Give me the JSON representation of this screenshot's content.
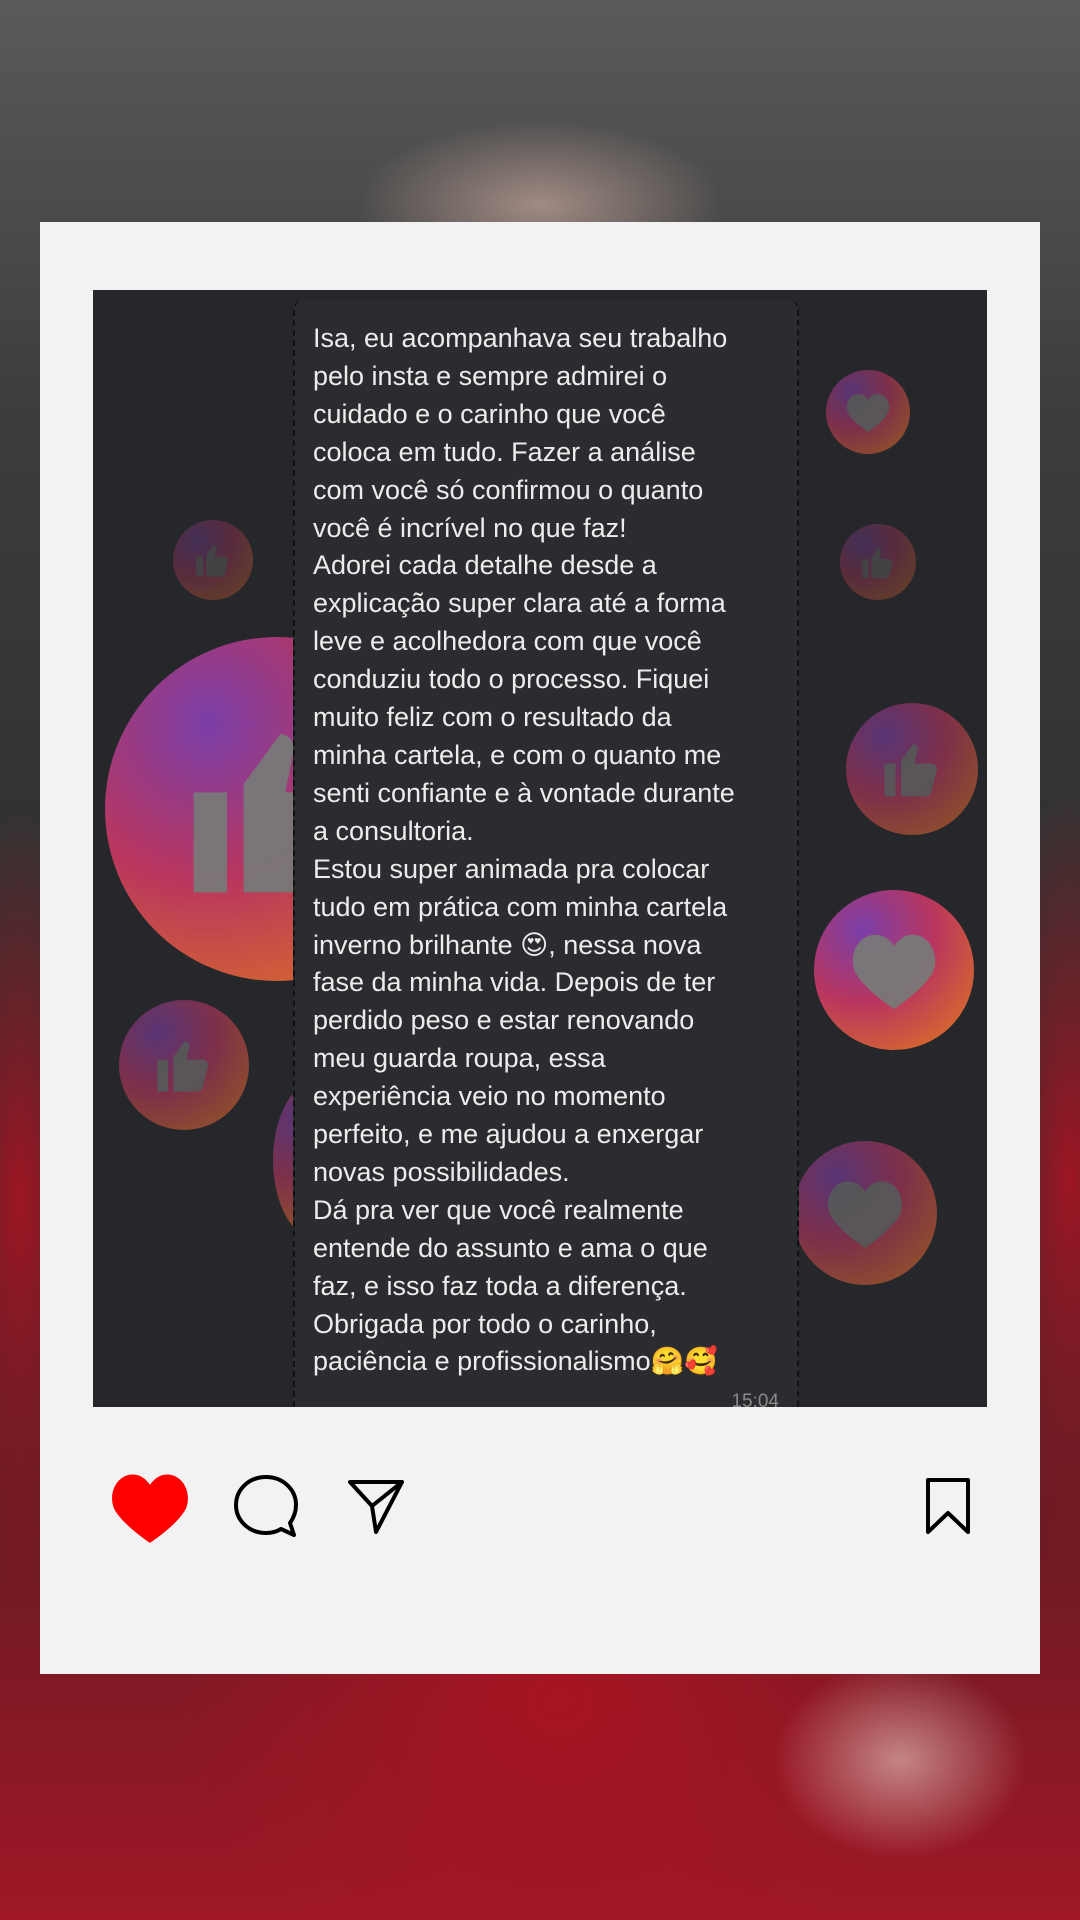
{
  "message": {
    "lines": [
      "Isa, eu acompanhava seu trabalho",
      "pelo insta e sempre admirei o",
      "cuidado e o carinho que você",
      "coloca em tudo. Fazer a análise",
      "com você só confirmou o quanto",
      "você é incrível no que faz!",
      "Adorei cada detalhe desde a",
      "explicação super clara até a forma",
      "leve e acolhedora com que você",
      "conduziu todo o processo. Fiquei",
      "muito feliz com o resultado da",
      "minha cartela, e com o quanto me",
      "senti confiante e à vontade durante",
      "a consultoria.",
      "Estou super animada pra colocar",
      "tudo em prática com minha cartela",
      "inverno brilhante 😍, nessa nova",
      "fase da minha vida. Depois de ter",
      "perdido peso e estar renovando",
      "meu guarda roupa, essa",
      "experiência veio no momento",
      "perfeito, e me ajudou a enxergar",
      "novas possibilidades.",
      "Dá pra ver que você realmente",
      "entende do assunto e ama o que",
      "faz, e isso faz toda a diferença.",
      "Obrigada por todo o carinho,",
      "paciência e profissionalismo🤗🥰"
    ],
    "time": "15:04"
  },
  "actions": {
    "like": {
      "icon": "heart-icon",
      "active": true,
      "color": "#ff0000"
    },
    "comment": {
      "icon": "comment-icon"
    },
    "share": {
      "icon": "send-icon"
    },
    "save": {
      "icon": "bookmark-icon"
    }
  },
  "colors": {
    "frame": "#f2f2f2",
    "chat_background": "#2b2c2f",
    "chat_text": "#ececec",
    "photo_background": "#26272a"
  }
}
